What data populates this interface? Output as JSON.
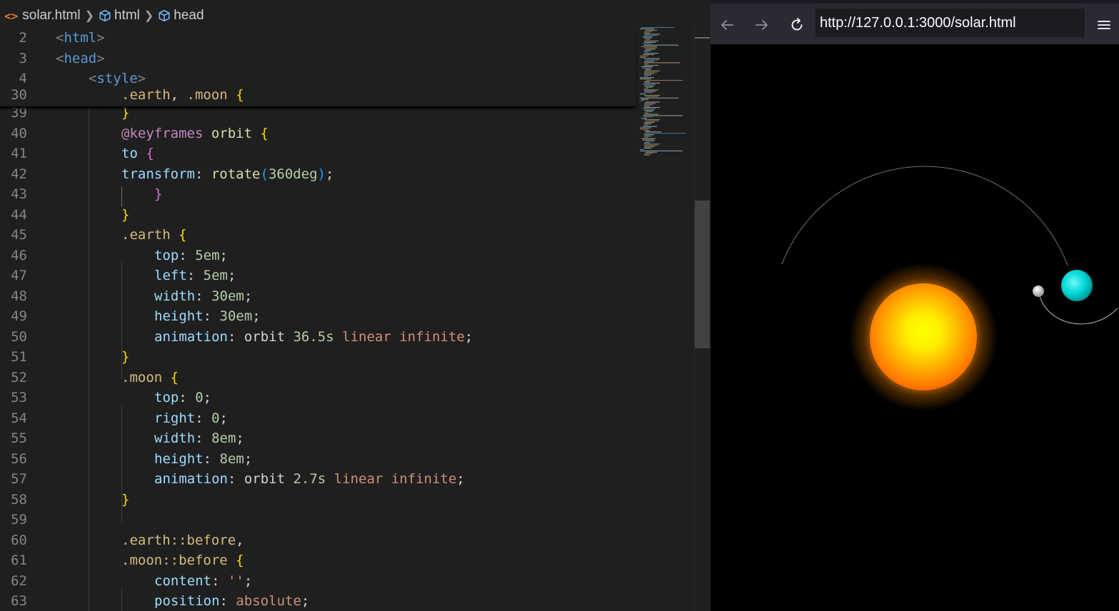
{
  "editor": {
    "breadcrumb": {
      "file": "solar.html",
      "path": [
        "html",
        "head"
      ]
    },
    "sticky_lines": [
      {
        "num": "2",
        "indent": 0,
        "tokens": [
          [
            "tag-b",
            "<"
          ],
          [
            "tag",
            "html"
          ],
          [
            "tag-b",
            ">"
          ]
        ]
      },
      {
        "num": "3",
        "indent": 0,
        "tokens": [
          [
            "tag-b",
            "<"
          ],
          [
            "tag",
            "head"
          ],
          [
            "tag-b",
            ">"
          ]
        ]
      },
      {
        "num": "4",
        "indent": 1,
        "tokens": [
          [
            "tag-b",
            "<"
          ],
          [
            "tag",
            "style"
          ],
          [
            "tag-b",
            ">"
          ]
        ]
      },
      {
        "num": "30",
        "indent": 2,
        "tokens": [
          [
            "sel",
            ".earth"
          ],
          [
            "plain",
            ", "
          ],
          [
            "sel",
            ".moon"
          ],
          [
            "plain",
            " "
          ],
          [
            "brace",
            "{"
          ]
        ]
      }
    ],
    "lines": [
      {
        "num": "39",
        "indent": 2,
        "tokens": [
          [
            "brace",
            "}"
          ]
        ]
      },
      {
        "num": "40",
        "indent": 2,
        "tokens": [
          [
            "at",
            "@keyframes"
          ],
          [
            "plain",
            " "
          ],
          [
            "fn",
            "orbit"
          ],
          [
            "plain",
            " "
          ],
          [
            "brace",
            "{"
          ]
        ]
      },
      {
        "num": "41",
        "indent": 2,
        "tokens": [
          [
            "prop",
            "to"
          ],
          [
            "plain",
            " "
          ],
          [
            "brace2",
            "{"
          ]
        ]
      },
      {
        "num": "42",
        "indent": 2,
        "tokens": [
          [
            "prop",
            "transform"
          ],
          [
            "plain",
            ": "
          ],
          [
            "fn",
            "rotate"
          ],
          [
            "brace3",
            "("
          ],
          [
            "num",
            "360deg"
          ],
          [
            "brace3",
            ")"
          ],
          [
            "plain",
            ";"
          ]
        ]
      },
      {
        "num": "43",
        "indent": 3,
        "tokens": [
          [
            "brace2",
            "}"
          ]
        ]
      },
      {
        "num": "44",
        "indent": 2,
        "tokens": [
          [
            "brace",
            "}"
          ]
        ]
      },
      {
        "num": "45",
        "indent": 2,
        "tokens": [
          [
            "sel",
            ".earth"
          ],
          [
            "plain",
            " "
          ],
          [
            "brace",
            "{"
          ]
        ]
      },
      {
        "num": "46",
        "indent": 3,
        "tokens": [
          [
            "prop",
            "top"
          ],
          [
            "plain",
            ": "
          ],
          [
            "num",
            "5em"
          ],
          [
            "plain",
            ";"
          ]
        ]
      },
      {
        "num": "47",
        "indent": 3,
        "tokens": [
          [
            "prop",
            "left"
          ],
          [
            "plain",
            ": "
          ],
          [
            "num",
            "5em"
          ],
          [
            "plain",
            ";"
          ]
        ]
      },
      {
        "num": "48",
        "indent": 3,
        "tokens": [
          [
            "prop",
            "width"
          ],
          [
            "plain",
            ": "
          ],
          [
            "num",
            "30em"
          ],
          [
            "plain",
            ";"
          ]
        ]
      },
      {
        "num": "49",
        "indent": 3,
        "tokens": [
          [
            "prop",
            "height"
          ],
          [
            "plain",
            ": "
          ],
          [
            "num",
            "30em"
          ],
          [
            "plain",
            ";"
          ]
        ]
      },
      {
        "num": "50",
        "indent": 3,
        "tokens": [
          [
            "prop",
            "animation"
          ],
          [
            "plain",
            ": orbit "
          ],
          [
            "num",
            "36.5s"
          ],
          [
            "plain",
            " "
          ],
          [
            "kw",
            "linear"
          ],
          [
            "plain",
            " "
          ],
          [
            "kw",
            "infinite"
          ],
          [
            "plain",
            ";"
          ]
        ]
      },
      {
        "num": "51",
        "indent": 2,
        "tokens": [
          [
            "brace",
            "}"
          ]
        ]
      },
      {
        "num": "52",
        "indent": 2,
        "tokens": [
          [
            "sel",
            ".moon"
          ],
          [
            "plain",
            " "
          ],
          [
            "brace",
            "{"
          ]
        ]
      },
      {
        "num": "53",
        "indent": 3,
        "tokens": [
          [
            "prop",
            "top"
          ],
          [
            "plain",
            ": "
          ],
          [
            "num",
            "0"
          ],
          [
            "plain",
            ";"
          ]
        ]
      },
      {
        "num": "54",
        "indent": 3,
        "tokens": [
          [
            "prop",
            "right"
          ],
          [
            "plain",
            ": "
          ],
          [
            "num",
            "0"
          ],
          [
            "plain",
            ";"
          ]
        ]
      },
      {
        "num": "55",
        "indent": 3,
        "tokens": [
          [
            "prop",
            "width"
          ],
          [
            "plain",
            ": "
          ],
          [
            "num",
            "8em"
          ],
          [
            "plain",
            ";"
          ]
        ]
      },
      {
        "num": "56",
        "indent": 3,
        "tokens": [
          [
            "prop",
            "height"
          ],
          [
            "plain",
            ": "
          ],
          [
            "num",
            "8em"
          ],
          [
            "plain",
            ";"
          ]
        ]
      },
      {
        "num": "57",
        "indent": 3,
        "tokens": [
          [
            "prop",
            "animation"
          ],
          [
            "plain",
            ": orbit "
          ],
          [
            "num",
            "2.7s"
          ],
          [
            "plain",
            " "
          ],
          [
            "kw",
            "linear"
          ],
          [
            "plain",
            " "
          ],
          [
            "kw",
            "infinite"
          ],
          [
            "plain",
            ";"
          ]
        ]
      },
      {
        "num": "58",
        "indent": 2,
        "tokens": [
          [
            "brace",
            "}"
          ]
        ]
      },
      {
        "num": "59",
        "indent": 2,
        "tokens": []
      },
      {
        "num": "60",
        "indent": 2,
        "tokens": [
          [
            "sel",
            ".earth::before"
          ],
          [
            "plain",
            ","
          ]
        ]
      },
      {
        "num": "61",
        "indent": 2,
        "tokens": [
          [
            "sel",
            ".moon::before"
          ],
          [
            "plain",
            " "
          ],
          [
            "brace",
            "{"
          ]
        ]
      },
      {
        "num": "62",
        "indent": 3,
        "tokens": [
          [
            "prop",
            "content"
          ],
          [
            "plain",
            ": "
          ],
          [
            "str",
            "''"
          ],
          [
            "plain",
            ";"
          ]
        ]
      },
      {
        "num": "63",
        "indent": 3,
        "tokens": [
          [
            "prop",
            "position"
          ],
          [
            "plain",
            ": "
          ],
          [
            "kw",
            "absolute"
          ],
          [
            "plain",
            ";"
          ]
        ]
      }
    ]
  },
  "browser": {
    "url": "http://127.0.0.1:3000/solar.html",
    "icons": {
      "back": "arrow-left-icon",
      "forward": "arrow-right-icon",
      "reload": "reload-icon",
      "menu": "hamburger-menu-icon"
    },
    "scene": {
      "sun_color_inner": "#ffff00",
      "sun_color_outer": "#ff6a00",
      "earth_color": "#00e5e5",
      "moon_color": "#d9d9d9",
      "orbit_color": "#bbbbbb"
    }
  }
}
